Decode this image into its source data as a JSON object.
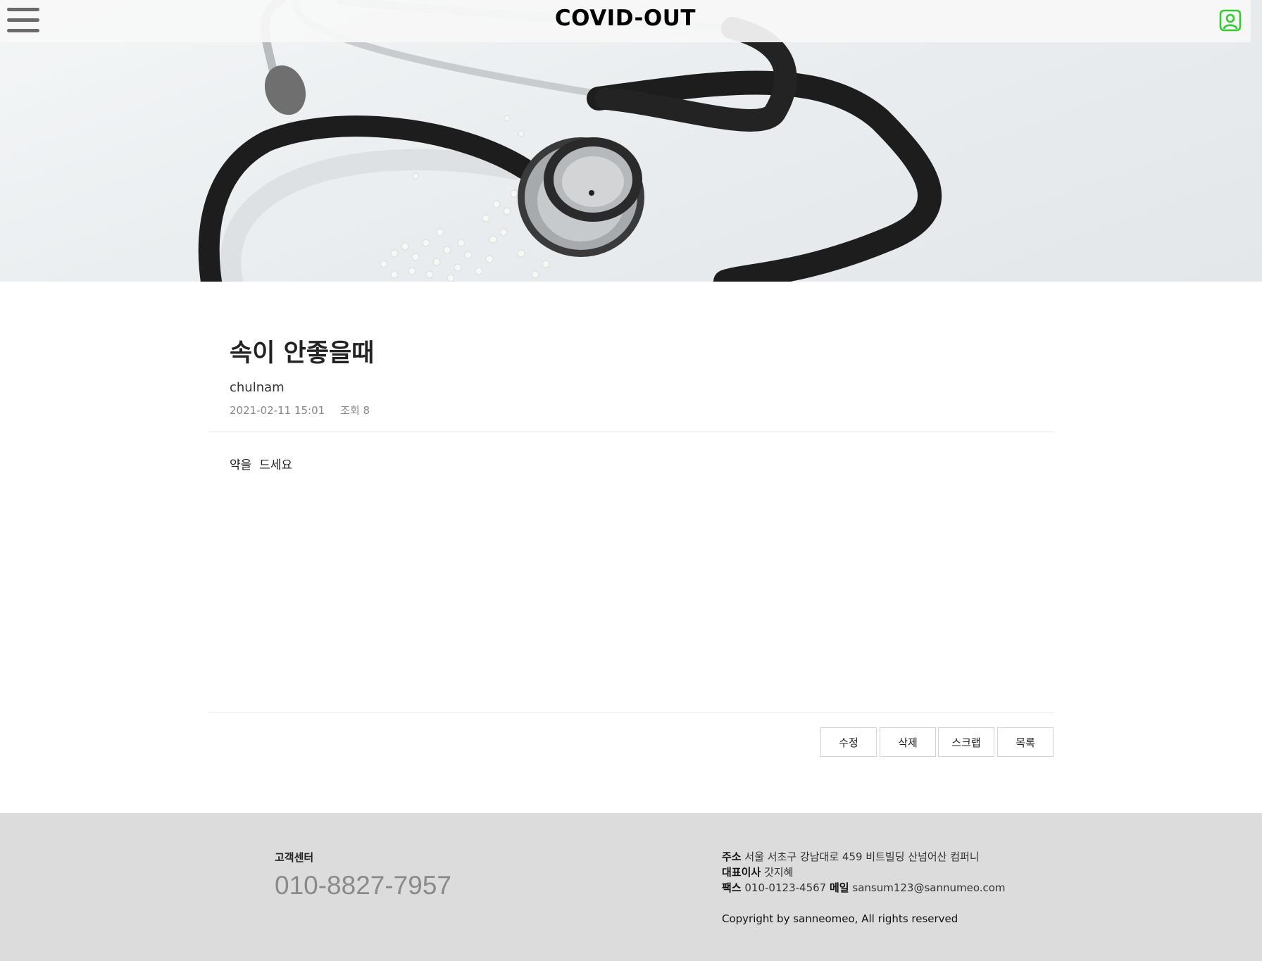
{
  "header": {
    "brand": "COVID-OUT",
    "menu_icon": "hamburger-menu-icon",
    "user_icon": "user-profile-icon",
    "accent_color": "#2ecc2e"
  },
  "hero": {
    "image": "stethoscope with white pills on light background"
  },
  "post": {
    "title": "속이 안좋을때",
    "author": "chulnam",
    "date": "2021-02-11 15:01",
    "views": "조회 8",
    "body": "약을  드세요"
  },
  "actions": {
    "edit": "수정",
    "delete": "삭제",
    "scrap": "스크랩",
    "list": "목록"
  },
  "footer": {
    "cs_label": "고객센터",
    "cs_phone": "010-8827-7957",
    "address_label": "주소",
    "address": "서울 서초구 강남대로 459 비트빌딩 산넘어산 컴퍼니",
    "ceo_label": "대표이사",
    "ceo": "갓지혜",
    "fax_label": "팩스",
    "fax": "010-0123-4567",
    "mail_label": "메일",
    "mail": "sansum123@sannumeo.com",
    "copyright": "Copyright by sanneomeo, All rights reserved"
  }
}
